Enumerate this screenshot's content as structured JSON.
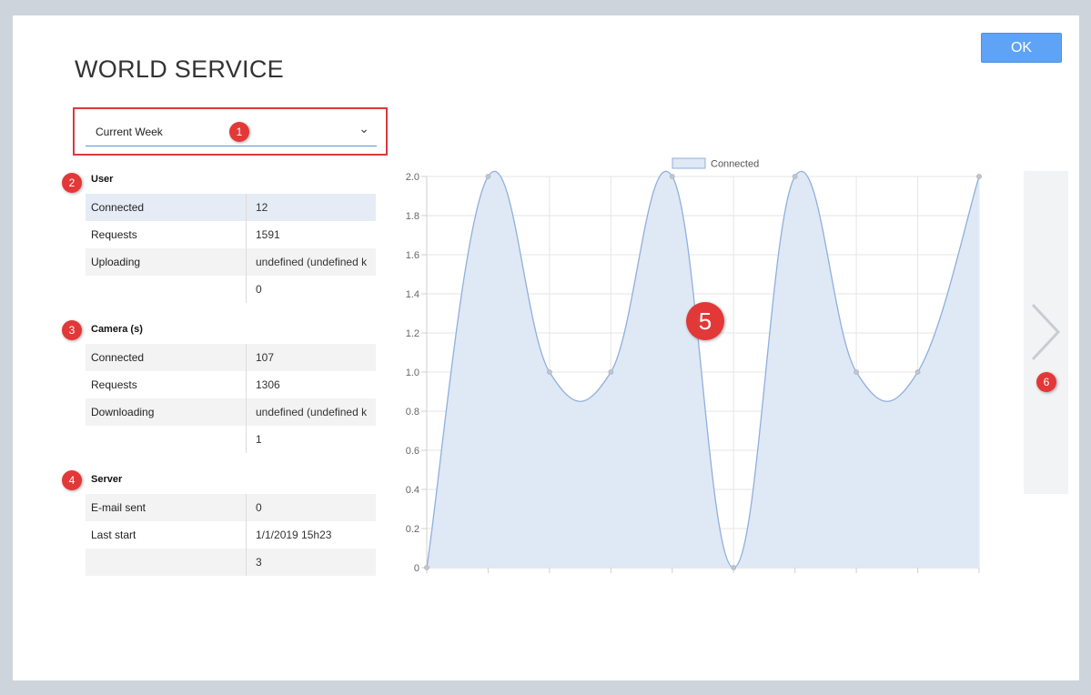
{
  "dialog": {
    "title": "WORLD SERVICE",
    "ok_label": "OK"
  },
  "period_select": {
    "value": "Current Week"
  },
  "badges": {
    "b1": "1",
    "b2": "2",
    "b3": "3",
    "b4": "4",
    "b5": "5",
    "b6": "6"
  },
  "user": {
    "title": "User",
    "rows": [
      {
        "label": "Connected",
        "value": "12"
      },
      {
        "label": "Requests",
        "value": "1591"
      },
      {
        "label": "Uploading",
        "value": "undefined (undefined k"
      },
      {
        "label": "",
        "value": "0"
      }
    ]
  },
  "camera": {
    "title": "Camera (s)",
    "rows": [
      {
        "label": "Connected",
        "value": "107"
      },
      {
        "label": "Requests",
        "value": "1306"
      },
      {
        "label": "Downloading",
        "value": "undefined (undefined k"
      },
      {
        "label": "",
        "value": "1"
      }
    ]
  },
  "server": {
    "title": "Server",
    "rows": [
      {
        "label": "E-mail sent",
        "value": "0"
      },
      {
        "label": "Last start",
        "value": "1/1/2019 15h23"
      },
      {
        "label": "",
        "value": "3"
      }
    ]
  },
  "chart_data": {
    "type": "area",
    "series": [
      {
        "name": "Connected",
        "values": [
          0,
          2,
          1,
          1,
          2,
          0,
          2,
          1,
          1,
          2
        ]
      }
    ],
    "x": [
      "",
      "",
      "",
      "",
      "",
      "",
      "",
      "",
      "",
      ""
    ],
    "ylim": [
      0,
      2.0
    ],
    "yticks": [
      "0",
      "0.2",
      "0.4",
      "0.6",
      "0.8",
      "1.0",
      "1.2",
      "1.4",
      "1.6",
      "1.8",
      "2.0"
    ],
    "grid": true,
    "legend": "top-center",
    "colors": {
      "line": "#8fb0dc",
      "fill": "#dfe8f5",
      "point": "#c2c6cc"
    }
  }
}
